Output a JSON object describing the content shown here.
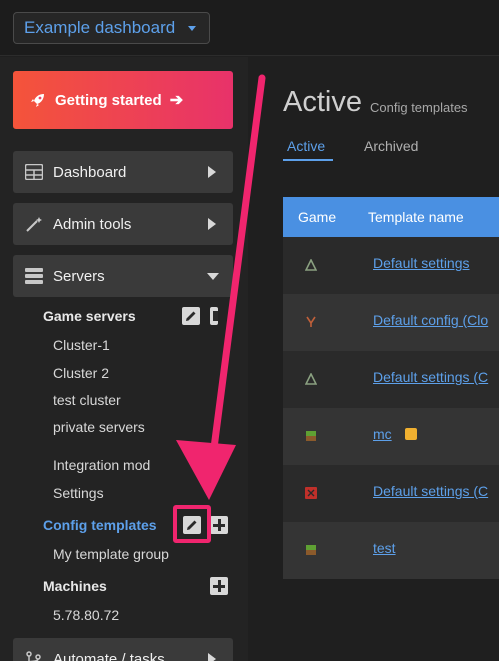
{
  "topbar": {
    "dashboard_select": "Example dashboard"
  },
  "sidebar": {
    "getting_started": "Getting started",
    "dashboard": "Dashboard",
    "admin_tools": "Admin tools",
    "servers": "Servers",
    "game_servers_heading": "Game servers",
    "game_servers": [
      "Cluster-1",
      "Cluster 2",
      "test cluster",
      "private servers"
    ],
    "integration_mod": "Integration mod",
    "settings": "Settings",
    "config_templates": "Config templates",
    "template_group": "My template group",
    "machines_heading": "Machines",
    "machine_ip": "5.78.80.72",
    "automate": "Automate / tasks"
  },
  "main": {
    "title": "Active",
    "subtitle": "Config templates",
    "tabs": [
      "Active",
      "Archived"
    ],
    "table": {
      "headers": [
        "Game",
        "Template name"
      ],
      "rows": [
        {
          "game_icon": "ark-icon",
          "name": "Default settings"
        },
        {
          "game_icon": "rust-icon",
          "name": "Default config (Clo"
        },
        {
          "game_icon": "ark-icon",
          "name": "Default settings (C"
        },
        {
          "game_icon": "minecraft-icon",
          "name": "mc",
          "note": true
        },
        {
          "game_icon": "seven-days-icon",
          "name": "Default settings (C"
        },
        {
          "game_icon": "minecraft-icon",
          "name": "test"
        }
      ]
    }
  },
  "colors": {
    "accent": "#5da0ea",
    "brand_gradient_start": "#f4543a",
    "brand_gradient_end": "#e8326a",
    "annotation": "#f0256e",
    "table_header": "#4a90e2"
  }
}
